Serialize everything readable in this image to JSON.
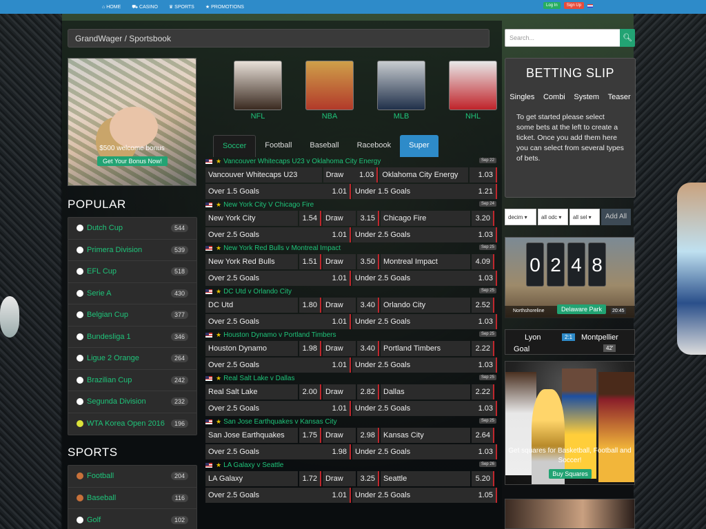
{
  "topnav": {
    "links": [
      {
        "label": "HOME",
        "icon": "home-icon"
      },
      {
        "label": "CASINO",
        "icon": "car-icon"
      },
      {
        "label": "SPORTS",
        "icon": "trophy-icon"
      },
      {
        "label": "PROMOTIONS",
        "icon": "star-icon"
      }
    ],
    "login_label": "Log In",
    "signup_label": "Sign Up"
  },
  "breadcrumb": "GrandWager  /  Sportsbook",
  "promo": {
    "text": "$500 welcome bonus",
    "button": "Get Your Bonus Now!"
  },
  "sport_tiles": [
    {
      "label": "NFL",
      "color_top": "#e8e0d8",
      "color_bottom": "#3a2a20"
    },
    {
      "label": "NBA",
      "color_top": "#cfa04a",
      "color_bottom": "#b23a2a"
    },
    {
      "label": "MLB",
      "color_top": "#c8ccd0",
      "color_bottom": "#20304a"
    },
    {
      "label": "NHL",
      "color_top": "#e8e8e8",
      "color_bottom": "#c0232a"
    }
  ],
  "tabs": [
    "Soccer",
    "Football",
    "Baseball",
    "Racebook",
    "Super"
  ],
  "events": [
    {
      "title": "Vancouver Whitecaps U23 v Oklahoma City Energy",
      "date": "Sep 22",
      "home": "Vancouver Whitecaps U23",
      "draw": "Draw",
      "home_odd": "1.03",
      "away": "Oklahoma City Energy",
      "away_odd": "1.03",
      "threeway": false,
      "over": "Over 1.5 Goals",
      "over_odd": "1.01",
      "under": "Under 1.5 Goals",
      "under_odd": "1.21"
    },
    {
      "title": "New York City V Chicago Fire",
      "date": "Sep 24",
      "home": "New York City",
      "home_odd": "1.54",
      "draw": "Draw",
      "draw_odd": "3.15",
      "away": "Chicago Fire",
      "away_odd": "3.20",
      "threeway": true,
      "over": "Over 2.5 Goals",
      "over_odd": "1.01",
      "under": "Under 2.5 Goals",
      "under_odd": "1.03"
    },
    {
      "title": "New York Red Bulls v Montreal Impact",
      "date": "Sep 25",
      "home": "New York Red Bulls",
      "home_odd": "1.51",
      "draw": "Draw",
      "draw_odd": "3.50",
      "away": "Montreal Impact",
      "away_odd": "4.09",
      "threeway": true,
      "over": "Over 2.5 Goals",
      "over_odd": "1.01",
      "under": "Under 2.5 Goals",
      "under_odd": "1.03"
    },
    {
      "title": "DC Utd v Orlando City",
      "date": "Sep 25",
      "home": "DC Utd",
      "home_odd": "1.80",
      "draw": "Draw",
      "draw_odd": "3.40",
      "away": "Orlando City",
      "away_odd": "2.52",
      "threeway": true,
      "over": "Over 2.5 Goals",
      "over_odd": "1.01",
      "under": "Under 2.5 Goals",
      "under_odd": "1.03"
    },
    {
      "title": "Houston Dynamo v Portland Timbers",
      "date": "Sep 25",
      "home": "Houston Dynamo",
      "home_odd": "1.98",
      "draw": "Draw",
      "draw_odd": "3.40",
      "away": "Portland Timbers",
      "away_odd": "2.22",
      "threeway": true,
      "over": "Over 2.5 Goals",
      "over_odd": "1.01",
      "under": "Under 2.5 Goals",
      "under_odd": "1.03"
    },
    {
      "title": "Real Salt Lake v Dallas",
      "date": "Sep 25",
      "home": "Real Salt Lake",
      "home_odd": "2.00",
      "draw": "Draw",
      "draw_odd": "2.82",
      "away": "Dallas",
      "away_odd": "2.22",
      "threeway": true,
      "over": "Over 2.5 Goals",
      "over_odd": "1.01",
      "under": "Under 2.5 Goals",
      "under_odd": "1.03"
    },
    {
      "title": "San Jose Earthquakes v Kansas City",
      "date": "Sep 25",
      "home": "San Jose Earthquakes",
      "home_odd": "1.75",
      "draw": "Draw",
      "draw_odd": "2.98",
      "away": "Kansas City",
      "away_odd": "2.64",
      "threeway": true,
      "over": "Over 2.5 Goals",
      "over_odd": "1.98",
      "under": "Under 2.5 Goals",
      "under_odd": "1.03"
    },
    {
      "title": "LA Galaxy v Seattle",
      "date": "Sep 26",
      "home": "LA Galaxy",
      "home_odd": "1.72",
      "draw": "Draw",
      "draw_odd": "3.25",
      "away": "Seattle",
      "away_odd": "5.20",
      "threeway": true,
      "over": "Over 2.5 Goals",
      "over_odd": "1.01",
      "under": "Under 2.5 Goals",
      "under_odd": "1.05"
    }
  ],
  "popular": {
    "title": "POPULAR",
    "items": [
      {
        "name": "Dutch Cup",
        "count": "544",
        "icon": "soccer-ball-icon"
      },
      {
        "name": "Primera Division",
        "count": "539",
        "icon": "soccer-ball-icon"
      },
      {
        "name": "EFL Cup",
        "count": "518",
        "icon": "soccer-ball-icon"
      },
      {
        "name": "Serie A",
        "count": "430",
        "icon": "soccer-ball-icon"
      },
      {
        "name": "Belgian Cup",
        "count": "377",
        "icon": "soccer-ball-icon"
      },
      {
        "name": "Bundesliga 1",
        "count": "346",
        "icon": "soccer-ball-icon"
      },
      {
        "name": "Ligue 2 Orange",
        "count": "264",
        "icon": "soccer-ball-icon"
      },
      {
        "name": "Brazilian Cup",
        "count": "242",
        "icon": "soccer-ball-icon"
      },
      {
        "name": "Segunda Division",
        "count": "232",
        "icon": "soccer-ball-icon"
      },
      {
        "name": "WTA Korea Open 2016",
        "count": "196",
        "icon": "tennis-ball-icon"
      }
    ]
  },
  "sports": {
    "title": "SPORTS",
    "items": [
      {
        "name": "Football",
        "count": "204",
        "icon": "football-icon"
      },
      {
        "name": "Baseball",
        "count": "116",
        "icon": "baseball-icon"
      },
      {
        "name": "Golf",
        "count": "102",
        "icon": "golf-icon"
      }
    ]
  },
  "search": {
    "placeholder": "Search..."
  },
  "slip": {
    "title": "BETTING SLIP",
    "options": [
      "Singles",
      "Combi",
      "System",
      "Teaser"
    ],
    "message": "To get started please select some bets at the left to create a ticket. Once you add them here you can select from several types of bets."
  },
  "controls": {
    "odds_format": "decim",
    "filter1": "all odc",
    "filter2": "all sel",
    "add_all": "Add All"
  },
  "horse": {
    "digits": [
      "0",
      "2",
      "4",
      "8"
    ],
    "left_label": "Northshoreline",
    "track": "Delaware Park",
    "time": "20:45"
  },
  "live": {
    "team1": "Lyon",
    "score": "2:1",
    "team2": "Montpellier",
    "event": "Goal",
    "minute": "42'"
  },
  "nba_promo": {
    "text": "Get squares for Basketball, Football and Soccer!",
    "button": "Buy Squares"
  }
}
